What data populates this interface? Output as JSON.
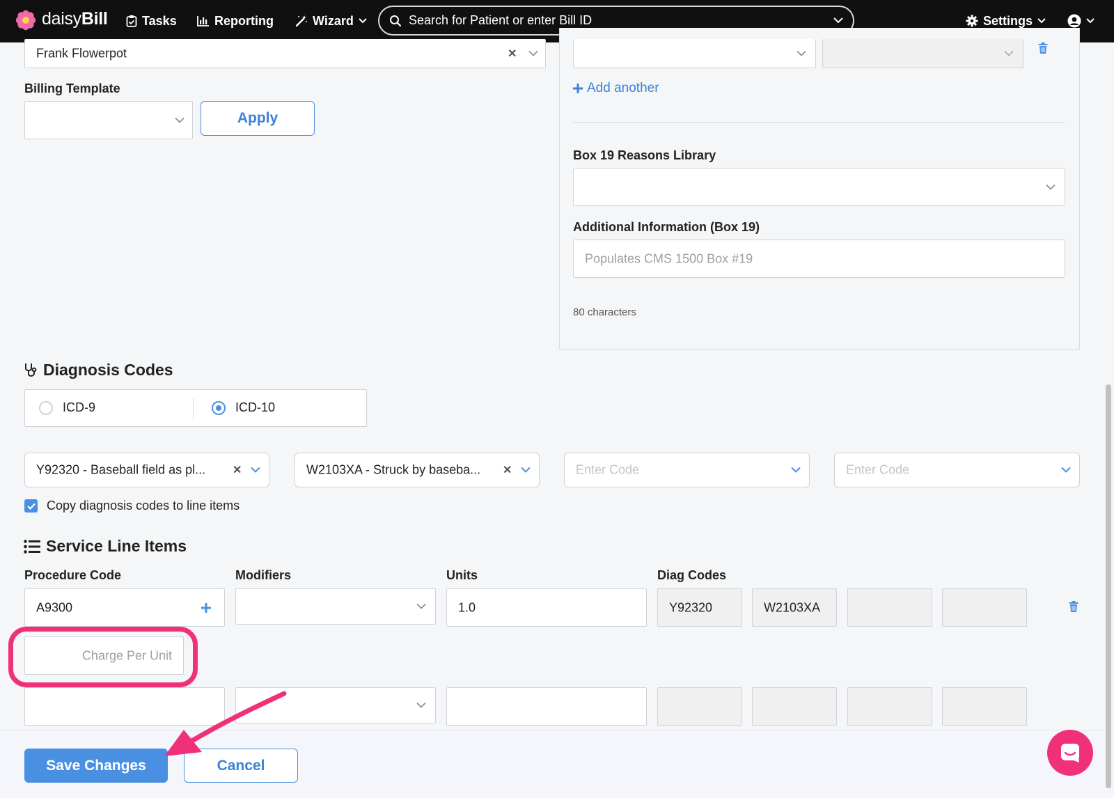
{
  "nav": {
    "brand_light": "daisy",
    "brand_bold": "Bill",
    "tasks": "Tasks",
    "reporting": "Reporting",
    "wizard": "Wizard",
    "search_placeholder": "Search for Patient or enter Bill ID",
    "settings": "Settings"
  },
  "form": {
    "provider_value": "Frank Flowerpot",
    "billing_template_label": "Billing Template",
    "apply_label": "Apply",
    "add_another": "Add another",
    "box19_library_label": "Box 19 Reasons Library",
    "additional_info_label": "Additional Information (Box 19)",
    "additional_info_placeholder": "Populates CMS 1500 Box #19",
    "char_count": "80 characters"
  },
  "diagnosis": {
    "title": "Diagnosis Codes",
    "icd9": "ICD-9",
    "icd10": "ICD-10",
    "selected": "ICD-10",
    "codes": [
      "Y92320 - Baseball field as pl...",
      "W2103XA - Struck by baseba..."
    ],
    "enter_code_placeholder": "Enter Code",
    "copy_label": "Copy diagnosis codes to line items",
    "copy_checked": true
  },
  "service": {
    "title": "Service Line Items",
    "headers": {
      "procedure": "Procedure Code",
      "modifiers": "Modifiers",
      "units": "Units",
      "diag": "Diag Codes"
    },
    "row1": {
      "procedure": "A9300",
      "units": "1.0",
      "diag": [
        "Y92320",
        "W2103XA"
      ]
    },
    "charge_placeholder": "Charge Per Unit"
  },
  "footer": {
    "save": "Save Changes",
    "cancel": "Cancel"
  },
  "colors": {
    "accent": "#4a90e2",
    "highlight": "#f0317a",
    "nav_bg": "#101010"
  }
}
